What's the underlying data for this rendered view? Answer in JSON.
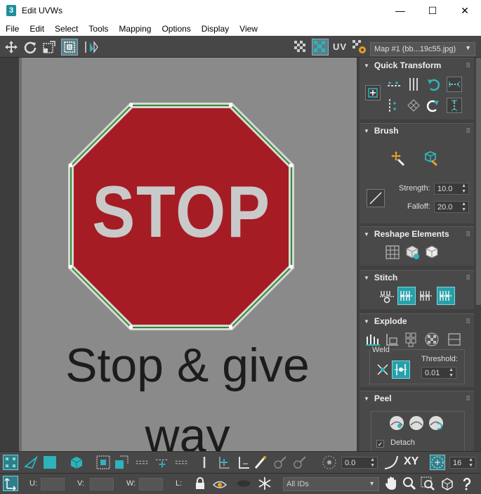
{
  "window": {
    "app_icon_text": "3",
    "title": "Edit UVWs",
    "minimize": "—",
    "maximize": "☐",
    "close": "✕"
  },
  "menu": [
    "File",
    "Edit",
    "Select",
    "Tools",
    "Mapping",
    "Options",
    "Display",
    "View"
  ],
  "toolbar": {
    "uv_label": "UV",
    "map_select": "Map #1 (bb...19c55.jpg)"
  },
  "viewport": {
    "sign_text": "STOP",
    "caption_line1": "Stop & give",
    "caption_line2": "way"
  },
  "panel": {
    "quick_transform": {
      "title": "Quick Transform"
    },
    "brush": {
      "title": "Brush",
      "strength_label": "Strength:",
      "strength_value": "10.0",
      "falloff_label": "Falloff:",
      "falloff_value": "20.0"
    },
    "reshape": {
      "title": "Reshape Elements"
    },
    "stitch": {
      "title": "Stitch"
    },
    "explode": {
      "title": "Explode",
      "weld_label": "Weld",
      "threshold_label": "Threshold:",
      "threshold_value": "0.01"
    },
    "peel": {
      "title": "Peel",
      "detach_label": "Detach",
      "detach_checked": true
    }
  },
  "bottom": {
    "angle_value": "0.0",
    "xy_label": "XY",
    "snap_value": "16",
    "u_label": "U:",
    "v_label": "V:",
    "w_label": "W:",
    "l_label": "L:",
    "ids_select": "All IDs"
  },
  "colors": {
    "accent": "#27a1a9",
    "sign_red": "#a51c24",
    "viewport_bg": "#8a8a8a",
    "panel_bg": "#494949"
  }
}
